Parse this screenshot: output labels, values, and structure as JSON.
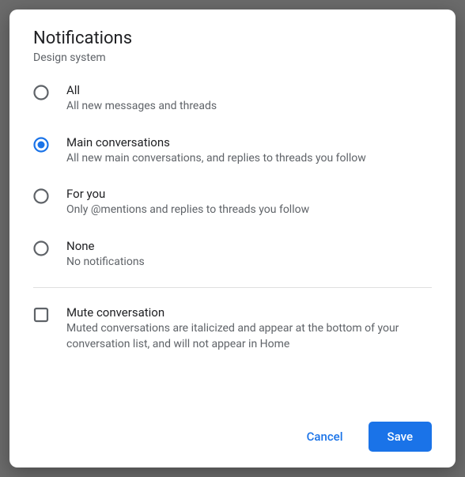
{
  "dialog": {
    "title": "Notifications",
    "subtitle": "Design system",
    "options": [
      {
        "label": "All",
        "desc": "All new messages and threads",
        "selected": false
      },
      {
        "label": "Main conversations",
        "desc": "All new main conversations, and replies to threads you follow",
        "selected": true
      },
      {
        "label": "For you",
        "desc": "Only @mentions and replies to threads you follow",
        "selected": false
      },
      {
        "label": "None",
        "desc": "No notifications",
        "selected": false
      }
    ],
    "mute": {
      "label": "Mute conversation",
      "desc": "Muted conversations are italicized and appear at the bottom of your conversation list, and will not appear in Home",
      "checked": false
    },
    "actions": {
      "cancel": "Cancel",
      "save": "Save"
    }
  },
  "colors": {
    "accent": "#1a73e8",
    "border": "#5f6368"
  }
}
